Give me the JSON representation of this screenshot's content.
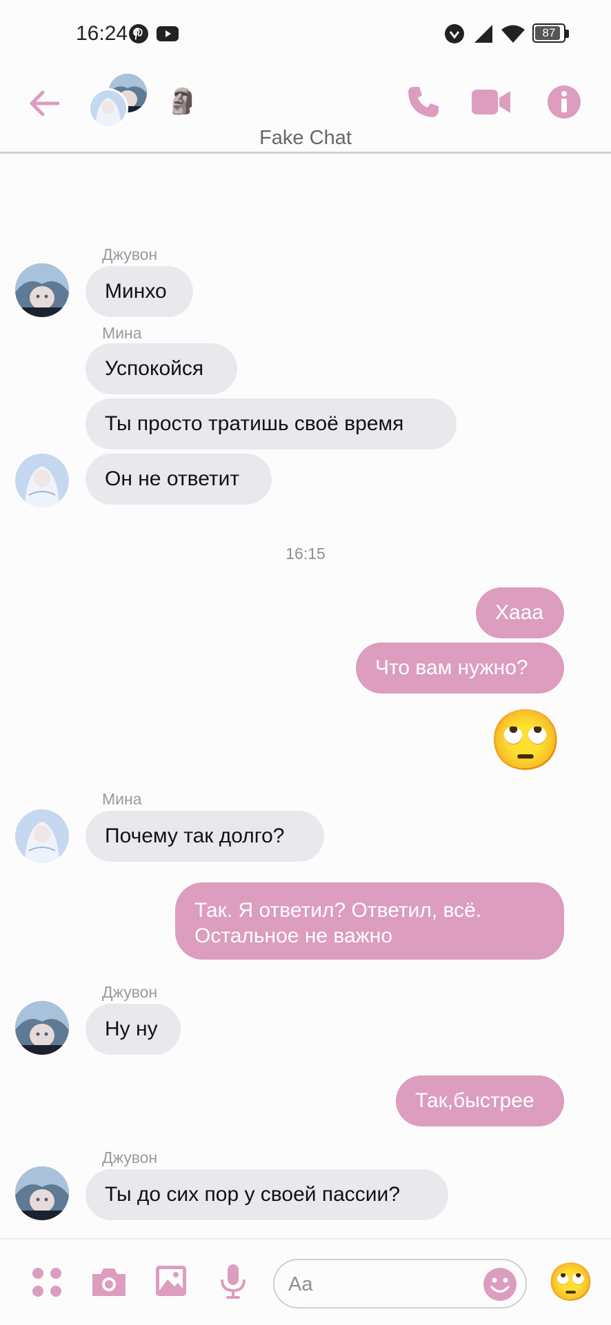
{
  "status_bar": {
    "time": "16:24",
    "battery": "87",
    "icons": [
      "pinterest-icon",
      "youtube-icon",
      "vpn-check-icon",
      "cellular-signal-icon",
      "wifi-icon",
      "battery-icon"
    ]
  },
  "header": {
    "title": "Fake Chat",
    "participant_emoji": "🗿",
    "icons": [
      "back-arrow-icon",
      "phone-icon",
      "video-camera-icon",
      "info-icon"
    ]
  },
  "accent_color": "#dc9dbf",
  "messages": {
    "m1": {
      "sender": "Джувон",
      "text": "Минхо"
    },
    "m2": {
      "sender": "Мина",
      "text": "Успокойся"
    },
    "m3": {
      "text": "Ты просто тратишь своё время"
    },
    "m4": {
      "text": "Он не ответит"
    },
    "time_separator": "16:15",
    "m5": {
      "text": "Хааа"
    },
    "m6": {
      "text": "Что вам нужно?"
    },
    "m7_emoji": "🙄",
    "m8": {
      "sender": "Мина",
      "text": "Почему так долго?"
    },
    "m9": {
      "line1": "Так. Я ответил? Ответил, всё.",
      "line2": "Остальное не важно"
    },
    "m10": {
      "sender": "Джувон",
      "text": "Ну ну"
    },
    "m11": {
      "text": "Так,быстрее"
    },
    "m12": {
      "sender": "Джувон",
      "text": "Ты до сих пор у своей пассии?"
    }
  },
  "composer": {
    "placeholder": "Aa",
    "quick_reaction": "🙄",
    "icons": [
      "apps-menu-icon",
      "camera-icon",
      "gallery-icon",
      "microphone-icon",
      "emoji-picker-icon"
    ]
  }
}
